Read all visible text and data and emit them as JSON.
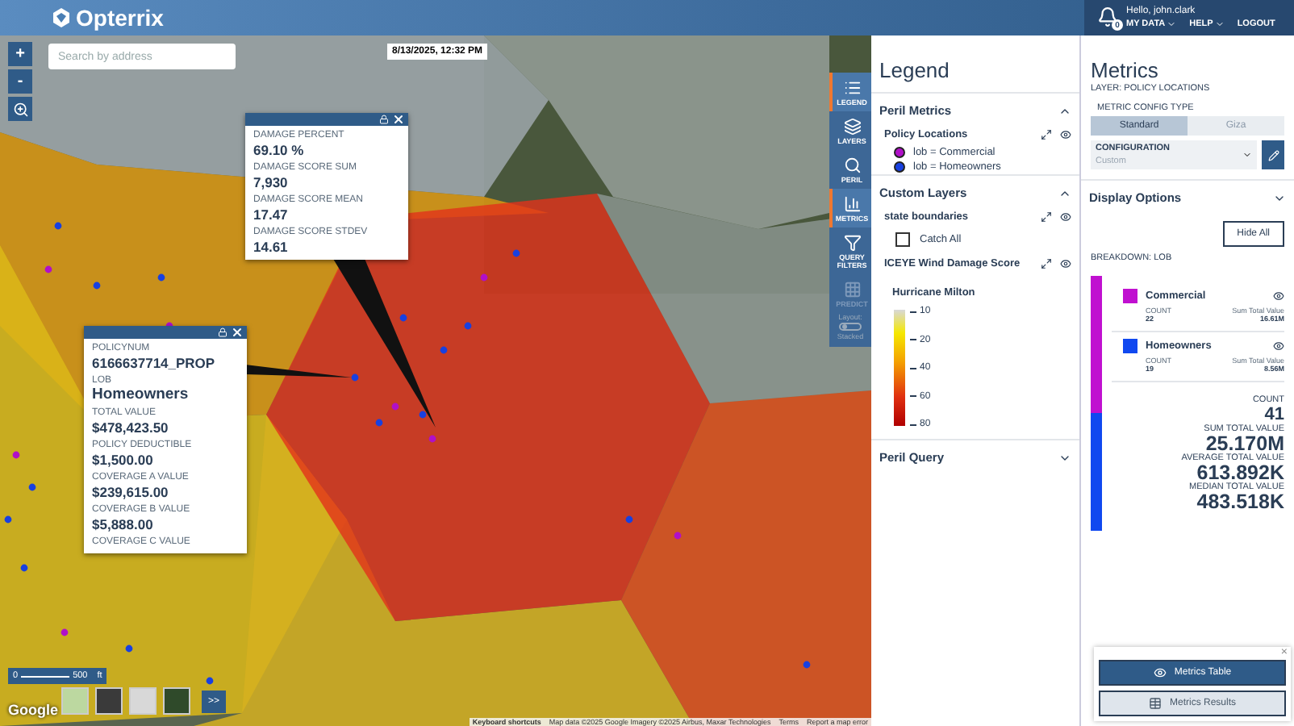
{
  "header": {
    "logo_text": "Opterrix",
    "notification_count": "0",
    "greeting": "Hello, john.clark",
    "menu": [
      {
        "label": "MY DATA",
        "dropdown": true
      },
      {
        "label": "HELP",
        "dropdown": true
      },
      {
        "label": "LOGOUT",
        "dropdown": false
      }
    ]
  },
  "map": {
    "search_placeholder": "Search by address",
    "timestamp": "8/13/2025, 12:32 PM",
    "zoom_controls": [
      "+",
      "-"
    ],
    "popups": [
      {
        "fields": [
          {
            "label": "DAMAGE PERCENT",
            "value": "69.10 %"
          },
          {
            "label": "DAMAGE SCORE SUM",
            "value": "7,930"
          },
          {
            "label": "DAMAGE SCORE MEAN",
            "value": "17.47"
          },
          {
            "label": "DAMAGE SCORE STDEV",
            "value": "14.61"
          }
        ]
      },
      {
        "fields": [
          {
            "label": "POLICYNUM",
            "value": "6166637714_PROP"
          },
          {
            "label": "LOB",
            "value": "Homeowners"
          },
          {
            "label": "TOTAL VALUE",
            "value": "$478,423.50"
          },
          {
            "label": "POLICY DEDUCTIBLE",
            "value": "$1,500.00"
          },
          {
            "label": "COVERAGE A VALUE",
            "value": "$239,615.00"
          },
          {
            "label": "COVERAGE B VALUE",
            "value": "$5,888.00"
          },
          {
            "label": "COVERAGE C VALUE"
          }
        ]
      }
    ],
    "scale": {
      "start": "0",
      "end": "500",
      "unit": "ft"
    },
    "google_label": "Google",
    "expand_button": ">>",
    "attribution": [
      "Keyboard shortcuts",
      "Map data ©2025 Google Imagery ©2025 Airbus, Maxar Technologies",
      "Terms",
      "Report a map error"
    ]
  },
  "toolbar": {
    "items": [
      {
        "label": "LEGEND",
        "selected": true,
        "disabled": false
      },
      {
        "label": "LAYERS",
        "selected": false,
        "disabled": false
      },
      {
        "label": "PERIL",
        "selected": false,
        "disabled": false
      },
      {
        "label": "METRICS",
        "selected": true,
        "disabled": false
      },
      {
        "label": "QUERY FILTERS",
        "selected": false,
        "disabled": false
      },
      {
        "label": "PREDICT",
        "selected": false,
        "disabled": true
      }
    ],
    "layout_label": "Layout:",
    "layout_on": false,
    "layout_value": "Stacked"
  },
  "legend": {
    "title": "Legend",
    "sections": [
      {
        "title": "Peril Metrics",
        "expanded": true,
        "layers": [
          {
            "kind": "points",
            "name": "Policy Locations",
            "entries": [
              {
                "label": "lob = Commercial",
                "color": "#b010c8"
              },
              {
                "label": "lob = Homeowners",
                "color": "#1840e0"
              }
            ]
          }
        ]
      },
      {
        "title": "Custom Layers",
        "expanded": true,
        "layers": [
          {
            "kind": "checkbox",
            "name": "state boundaries",
            "option": {
              "label": "Catch All",
              "checked": false
            }
          },
          {
            "kind": "scale",
            "name": "ICEYE Wind Damage Score",
            "subtitle": "Hurricane Milton",
            "ticks": [
              "10",
              "20",
              "40",
              "60",
              "80"
            ]
          }
        ]
      },
      {
        "title": "Peril Query",
        "expanded": false
      }
    ]
  },
  "metrics": {
    "title": "Metrics",
    "layer_label": "LAYER: POLICY LOCATIONS",
    "config_type_label": "METRIC CONFIG TYPE",
    "config_types": [
      {
        "label": "Standard",
        "selected": true
      },
      {
        "label": "Giza",
        "selected": false
      }
    ],
    "configuration_label": "CONFIGURATION",
    "configuration_value": "Custom",
    "display_options": {
      "title": "Display Options",
      "expanded": false
    },
    "hide_all": "Hide All",
    "breakdown_label": "BREAKDOWN: LOB",
    "breakdown": [
      {
        "name": "Commercial",
        "color": "#c010d0",
        "count_label": "COUNT",
        "count": "22",
        "sum_label": "Sum Total Value",
        "sum": "16.61M",
        "level": 0.54
      },
      {
        "name": "Homeowners",
        "color": "#1048f0",
        "count_label": "COUNT",
        "count": "19",
        "sum_label": "Sum Total Value",
        "sum": "8.56M",
        "level": 0.46
      }
    ],
    "totals": [
      {
        "label": "COUNT",
        "value": "41"
      },
      {
        "label": "SUM TOTAL VALUE",
        "value": "25.170M"
      },
      {
        "label": "AVERAGE TOTAL VALUE",
        "value": "613.892K"
      },
      {
        "label": "MEDIAN TOTAL VALUE",
        "value": "483.518K"
      }
    ],
    "dock": {
      "close": "×",
      "buttons": [
        {
          "label": "Metrics Table",
          "kind": "primary"
        },
        {
          "label": "Metrics Results",
          "kind": "secondary"
        }
      ]
    }
  }
}
